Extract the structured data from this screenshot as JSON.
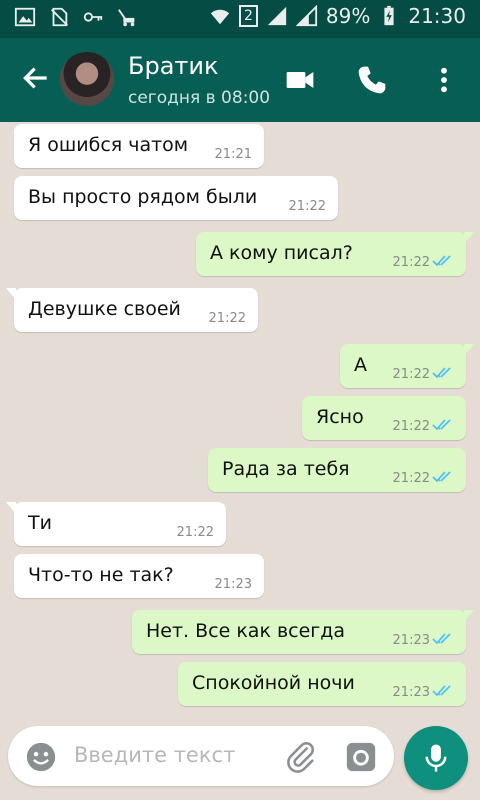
{
  "status_bar": {
    "sim_badge": "2",
    "battery_percent": "89%",
    "time": "21:30"
  },
  "header": {
    "contact_name": "Братик",
    "last_seen": "сегодня в 08:00"
  },
  "messages": [
    {
      "direction": "in",
      "text": "Я ошибся чатом",
      "time": "21:21"
    },
    {
      "direction": "in",
      "text": "Вы просто рядом были",
      "time": "21:22"
    },
    {
      "direction": "out",
      "text": "А кому писал?",
      "time": "21:22",
      "status": "read"
    },
    {
      "direction": "in",
      "text": "Девушке своей",
      "time": "21:22"
    },
    {
      "direction": "out",
      "text": "А",
      "time": "21:22",
      "status": "read"
    },
    {
      "direction": "out",
      "text": "Ясно",
      "time": "21:22",
      "status": "read"
    },
    {
      "direction": "out",
      "text": "Рада за тебя",
      "time": "21:22",
      "status": "read"
    },
    {
      "direction": "in",
      "text": "Ти",
      "time": "21:22"
    },
    {
      "direction": "in",
      "text": "Что-то не так?",
      "time": "21:23"
    },
    {
      "direction": "out",
      "text": "Нет. Все как всегда",
      "time": "21:23",
      "status": "read"
    },
    {
      "direction": "out",
      "text": "Спокойной ночи",
      "time": "21:23",
      "status": "read"
    }
  ],
  "composer": {
    "placeholder": "Введите текст"
  },
  "colors": {
    "header": "#075e54",
    "status_bar": "#054d44",
    "outgoing_bubble": "#dcf8c6",
    "incoming_bubble": "#ffffff",
    "read_ticks": "#4fc3f7",
    "mic_button": "#0f8f7e"
  },
  "icons": [
    "gallery-icon",
    "no-sim-icon",
    "key-icon",
    "mower-icon",
    "wifi-icon",
    "signal-icon",
    "battery-icon",
    "back-arrow-icon",
    "video-call-icon",
    "phone-icon",
    "more-vert-icon",
    "emoji-icon",
    "attach-icon",
    "camera-icon",
    "mic-icon"
  ]
}
